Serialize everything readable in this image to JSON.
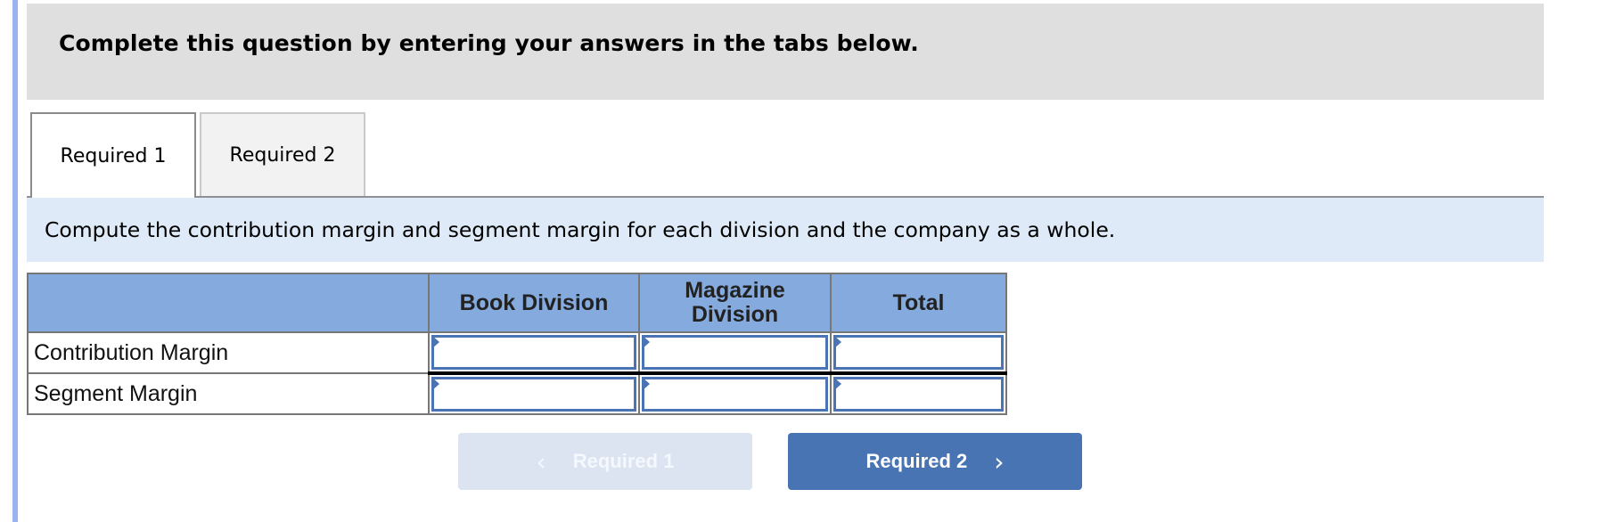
{
  "banner": {
    "text": "Complete this question by entering your answers in the tabs below."
  },
  "tabs": [
    {
      "label": "Required 1",
      "active": true
    },
    {
      "label": "Required 2",
      "active": false
    }
  ],
  "instruction": "Compute the contribution margin and segment margin for each division and the company as a whole.",
  "table": {
    "columns": [
      "",
      "Book Division",
      "Magazine Division",
      "Total"
    ],
    "columns_lines": {
      "magazine_line1": "Magazine",
      "magazine_line2": "Division"
    },
    "rows": [
      {
        "label": "Contribution Margin",
        "values": [
          "",
          "",
          ""
        ]
      },
      {
        "label": "Segment Margin",
        "values": [
          "",
          "",
          ""
        ]
      }
    ]
  },
  "nav": {
    "prev": {
      "label": "Required 1",
      "icon": "chevron-left-icon",
      "glyph": "‹",
      "disabled": true
    },
    "next": {
      "label": "Required 2",
      "icon": "chevron-right-icon",
      "glyph": "›",
      "disabled": false
    }
  },
  "colors": {
    "header_bg": "#84aade",
    "input_border": "#4a74b4",
    "next_button": "#4874b4",
    "prev_button_disabled": "#dbe4f0",
    "instruction_bg": "#deeaf7",
    "banner_bg": "#dfdfdf"
  }
}
